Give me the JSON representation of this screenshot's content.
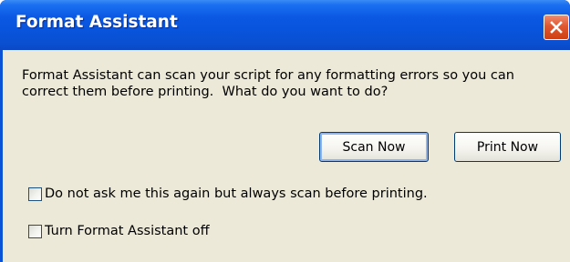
{
  "window": {
    "title": "Format Assistant",
    "close_icon": "close-icon",
    "colors": {
      "titlebar": "#0a55dd",
      "close_button": "#e0572f",
      "client_background": "#ece9d8",
      "button_border": "#003c74"
    }
  },
  "message": "Format Assistant can scan your script for any formatting errors so you can correct them before printing.  What do you want to do?",
  "buttons": {
    "scan_now": "Scan Now",
    "print_now": "Print Now"
  },
  "options": [
    {
      "label": "Do not ask me this again but always scan before printing.",
      "checked": false
    },
    {
      "label": "Turn Format Assistant off",
      "checked": false
    }
  ]
}
